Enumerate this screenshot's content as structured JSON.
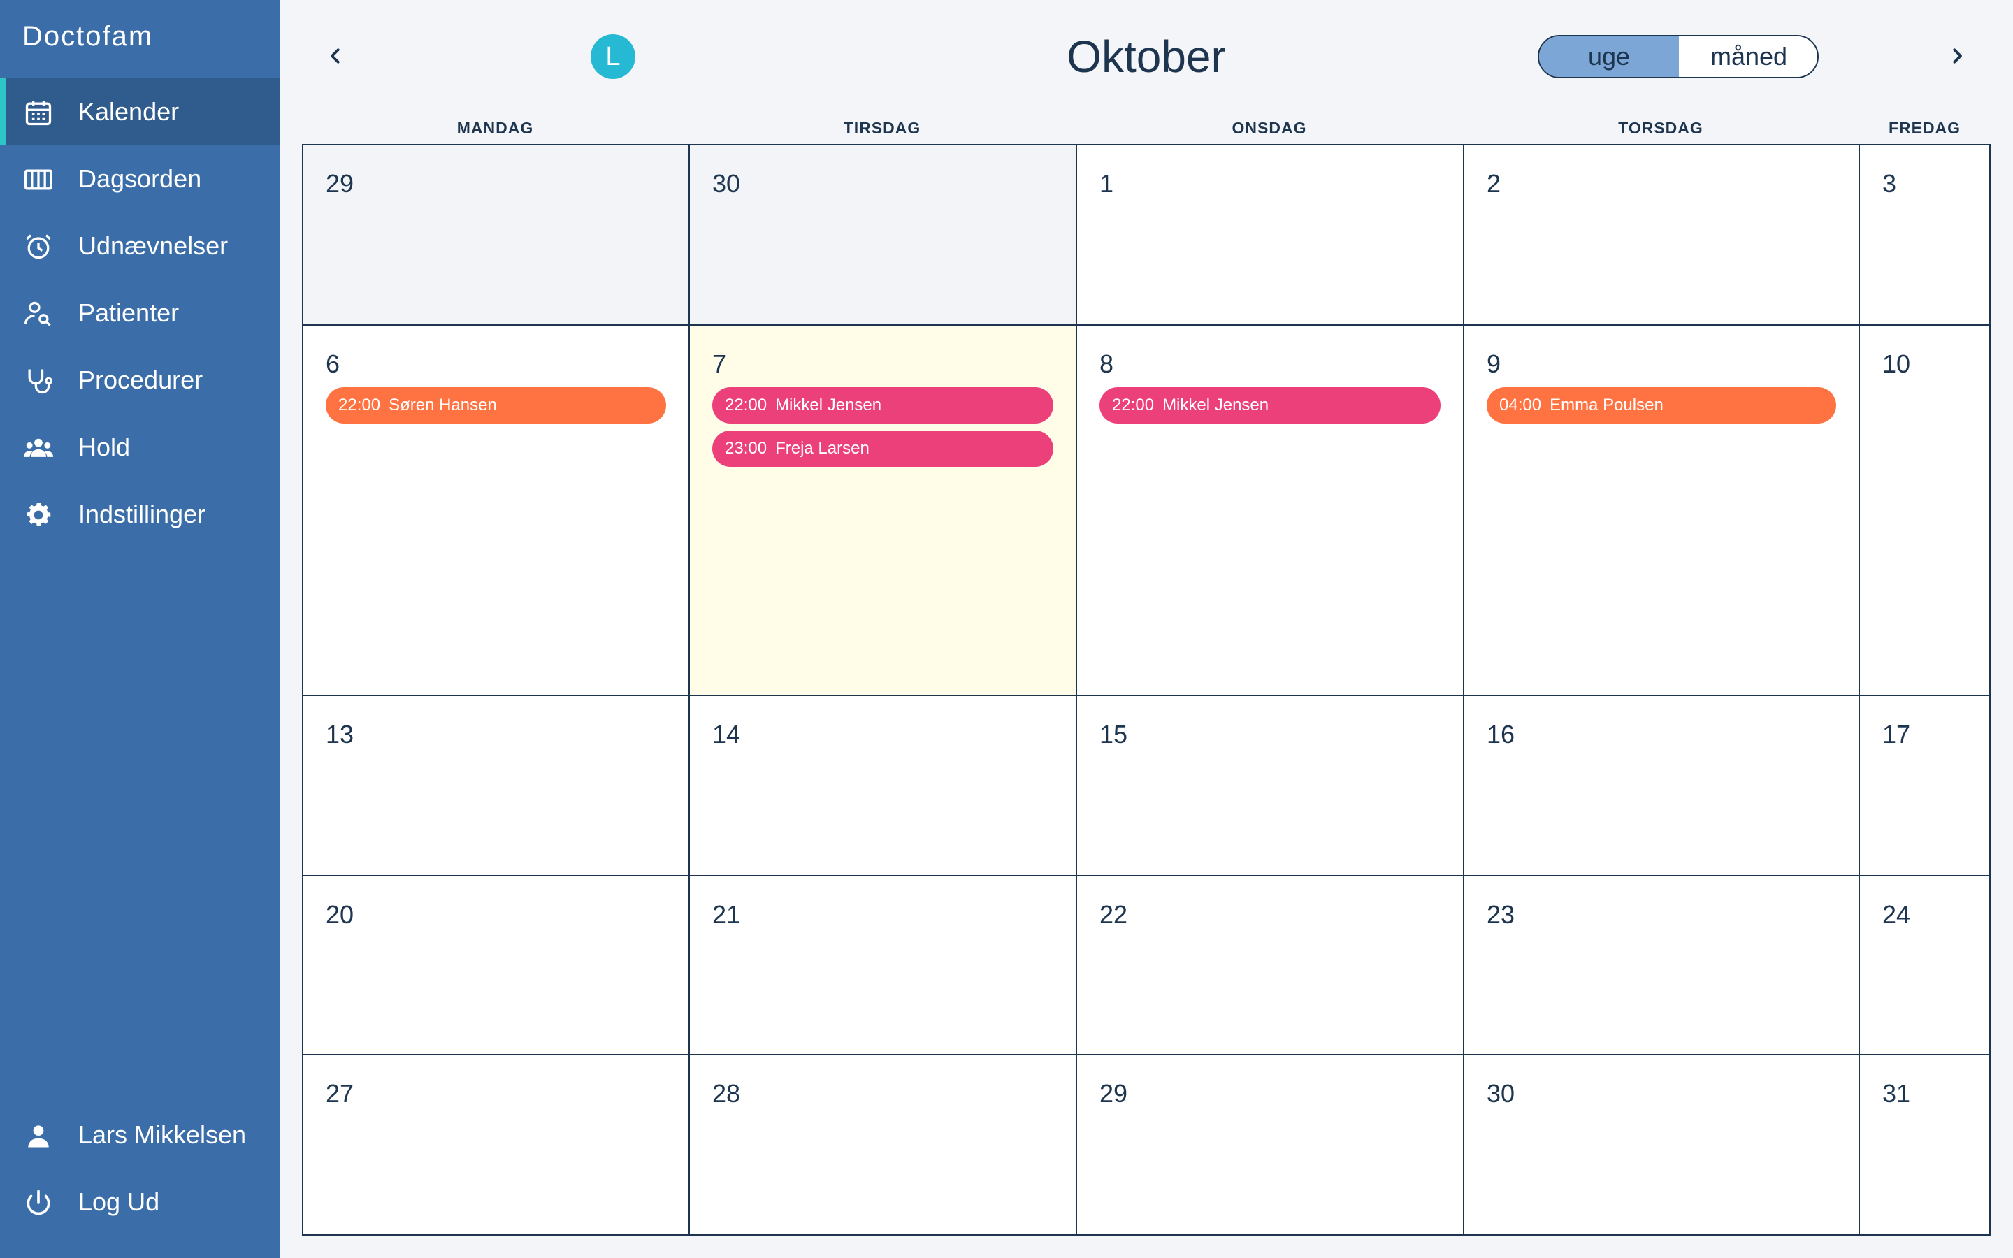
{
  "app": {
    "brand": "Doctofam"
  },
  "sidebar": {
    "items": [
      {
        "label": "Kalender",
        "icon": "calendar-icon",
        "active": true
      },
      {
        "label": "Dagsorden",
        "icon": "columns-icon"
      },
      {
        "label": "Udnævnelser",
        "icon": "alarm-clock-icon"
      },
      {
        "label": "Patienter",
        "icon": "person-search-icon"
      },
      {
        "label": "Procedurer",
        "icon": "stethoscope-icon"
      },
      {
        "label": "Hold",
        "icon": "group-icon"
      },
      {
        "label": "Indstillinger",
        "icon": "gear-icon"
      }
    ],
    "user": {
      "label": "Lars Mikkelsen",
      "icon": "user-icon"
    },
    "logout": {
      "label": "Log Ud",
      "icon": "power-icon"
    }
  },
  "header": {
    "avatar_initial": "L",
    "month": "Oktober",
    "view_week": "uge",
    "view_month": "måned",
    "active_view": "uge"
  },
  "calendar": {
    "days": [
      "MANDAG",
      "TIRSDAG",
      "ONSDAG",
      "TORSDAG",
      "FREDAG"
    ],
    "weeks": [
      [
        {
          "day": "29",
          "other": true
        },
        {
          "day": "30",
          "other": true
        },
        {
          "day": "1"
        },
        {
          "day": "2"
        },
        {
          "day": "3"
        }
      ],
      [
        {
          "day": "6",
          "events": [
            {
              "time": "22:00",
              "name": "Søren Hansen",
              "color": "#ff7241"
            }
          ]
        },
        {
          "day": "7",
          "today": true,
          "events": [
            {
              "time": "22:00",
              "name": "Mikkel Jensen",
              "color": "#ec407a"
            },
            {
              "time": "23:00",
              "name": "Freja Larsen",
              "color": "#ec407a"
            }
          ]
        },
        {
          "day": "8",
          "events": [
            {
              "time": "22:00",
              "name": "Mikkel Jensen",
              "color": "#ec407a"
            }
          ]
        },
        {
          "day": "9",
          "events": [
            {
              "time": "04:00",
              "name": "Emma Poulsen",
              "color": "#ff7241"
            }
          ]
        },
        {
          "day": "10"
        }
      ],
      [
        {
          "day": "13"
        },
        {
          "day": "14"
        },
        {
          "day": "15"
        },
        {
          "day": "16"
        },
        {
          "day": "17"
        }
      ],
      [
        {
          "day": "20"
        },
        {
          "day": "21"
        },
        {
          "day": "22"
        },
        {
          "day": "23"
        },
        {
          "day": "24"
        }
      ],
      [
        {
          "day": "27"
        },
        {
          "day": "28"
        },
        {
          "day": "29"
        },
        {
          "day": "30"
        },
        {
          "day": "31"
        }
      ]
    ]
  },
  "colors": {
    "sidebar": "#3b6ea8",
    "sidebar_active": "#2f5c8d",
    "accent": "#2ec5c9",
    "event_orange": "#ff7241",
    "event_pink": "#ec407a",
    "today_bg": "#fffde8"
  }
}
